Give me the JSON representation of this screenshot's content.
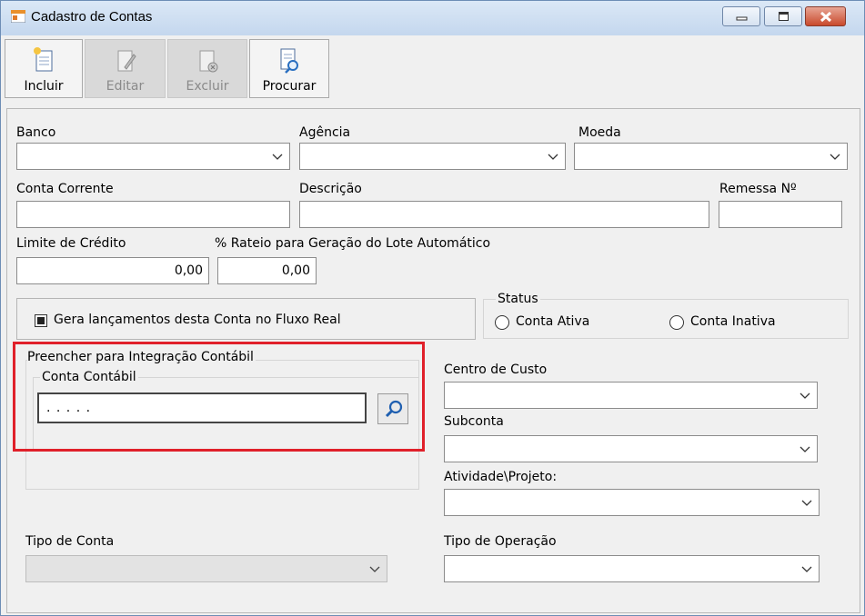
{
  "window": {
    "title": "Cadastro de Contas"
  },
  "toolbar": {
    "incluir": "Incluir",
    "editar": "Editar",
    "excluir": "Excluir",
    "procurar": "Procurar"
  },
  "form": {
    "banco_label": "Banco",
    "agencia_label": "Agência",
    "moeda_label": "Moeda",
    "conta_corrente_label": "Conta Corrente",
    "descricao_label": "Descrição",
    "remessa_label": "Remessa Nº",
    "limite_label": "Limite de Crédito",
    "limite_value": "0,00",
    "rateio_label": "% Rateio para Geração do Lote Automático",
    "rateio_value": "0,00",
    "fluxo_checkbox_label": "Gera lançamentos desta Conta no Fluxo Real",
    "status_title": "Status",
    "status_ativa": "Conta Ativa",
    "status_inativa": "Conta Inativa",
    "integracao_title": "Preencher para Integração Contábil",
    "conta_contabil_title": "Conta Contábil",
    "conta_contabil_value": ". . . . .",
    "centro_custo_label": "Centro de Custo",
    "subconta_label": "Subconta",
    "atividade_label": "Atividade\\Projeto:",
    "tipo_conta_label": "Tipo de Conta",
    "tipo_operacao_label": "Tipo de Operação"
  },
  "colors": {
    "highlight": "#e0202a",
    "titlebar": "#c4d7ee"
  },
  "icons": [
    "app-icon",
    "minimize-icon",
    "maximize-icon",
    "close-icon",
    "new-document-icon",
    "edit-document-icon",
    "delete-document-icon",
    "search-document-icon",
    "chevron-down-icon",
    "magnifier-icon"
  ]
}
